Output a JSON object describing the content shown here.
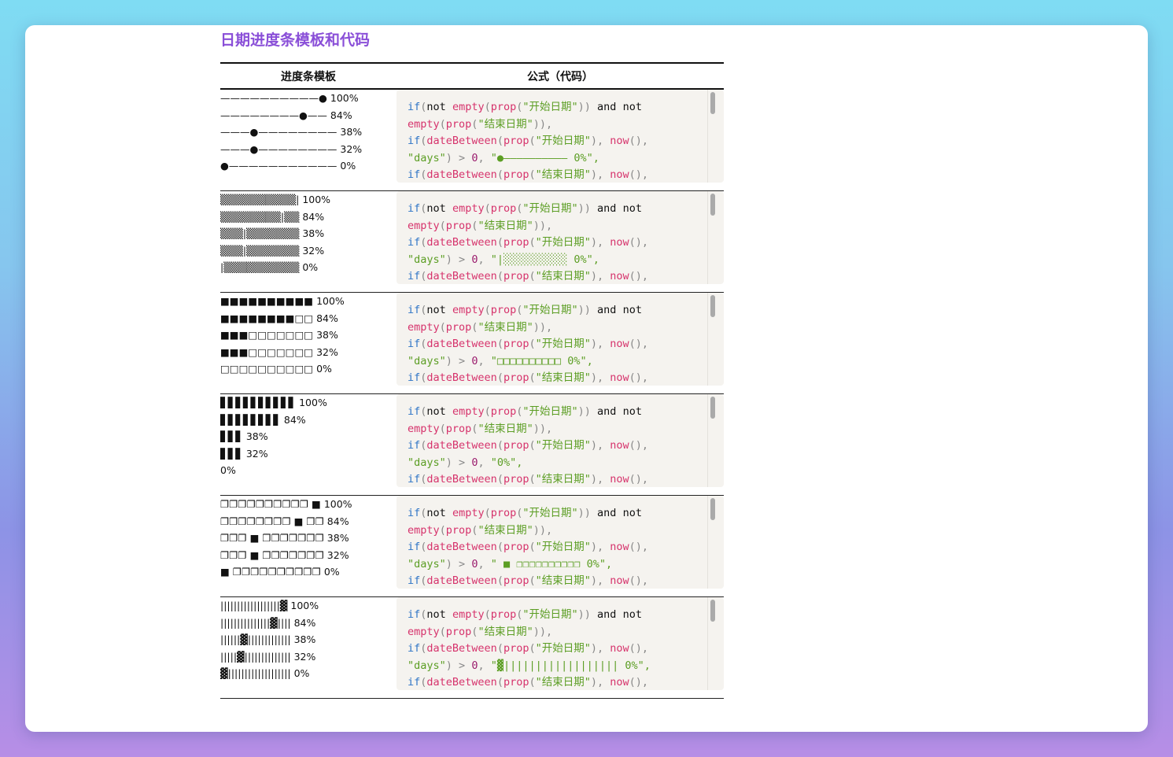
{
  "page": {
    "title": "日期进度条模板和代码"
  },
  "table": {
    "headers": {
      "template": "进度条模板",
      "formula": "公式（代码）"
    },
    "rows": [
      {
        "bars": [
          "——————————● 100%",
          "————————●—— 84%",
          "———●———————— 38%",
          "———●———————— 32%",
          "●——————————— 0%"
        ],
        "code_fill": "\"●—————————— 0%\","
      },
      {
        "bars": [
          "▒▒▒▒▒▒▒▒▒▒| 100%",
          "▒▒▒▒▒▒▒▒|▒▒ 84%",
          "▒▒▒|▒▒▒▒▒▒▒ 38%",
          "▒▒▒|▒▒▒▒▒▒▒ 32%",
          "|▒▒▒▒▒▒▒▒▒▒ 0%"
        ],
        "code_fill": "\"|░░░░░░░░░░ 0%\","
      },
      {
        "bars": [
          "■■■■■■■■■■ 100%",
          "■■■■■■■■□□ 84%",
          "■■■□□□□□□□ 38%",
          "■■■□□□□□□□ 32%",
          "□□□□□□□□□□ 0%"
        ],
        "code_fill": "\"□□□□□□□□□□ 0%\","
      },
      {
        "bars": [
          "▋▋▋▋▋▋▋▋▋▋ 100%",
          "▋▋▋▋▋▋▋▋ 84%",
          "▋▋▋ 38%",
          "▋▋▋ 32%",
          "0%"
        ],
        "code_fill": "\"0%\","
      },
      {
        "bars": [
          "❐❐❐❐❐❐❐❐❐❐ ■ 100%",
          "❐❐❐❐❐❐❐❐ ■ ❐❐ 84%",
          "❐❐❐ ■ ❐❐❐❐❐❐❐ 38%",
          "❐❐❐ ■ ❐❐❐❐❐❐❐ 32%",
          "■ ❐❐❐❐❐❐❐❐❐❐ 0%"
        ],
        "code_fill": "\" ■ ❐❐❐❐❐❐❐❐❐❐ 0%\","
      },
      {
        "bars": [
          "||||||||||||||||||▓ 100%",
          "|||||||||||||||▓|||| 84%",
          "||||||▓||||||||||||| 38%",
          "|||||▓|||||||||||||| 32%",
          "▓||||||||||||||||||| 0%"
        ],
        "code_fill": "\"▓|||||||||||||||||| 0%\","
      }
    ],
    "code_common": {
      "if": "if",
      "not": "not",
      "and": "and",
      "empty": "empty",
      "prop": "prop",
      "start": "\"开始日期\"",
      "end": "\"结束日期\"",
      "dateBetween": "dateBetween",
      "now": "now",
      "days": "\"days\"",
      "gt": ">",
      "zero": "0"
    }
  }
}
